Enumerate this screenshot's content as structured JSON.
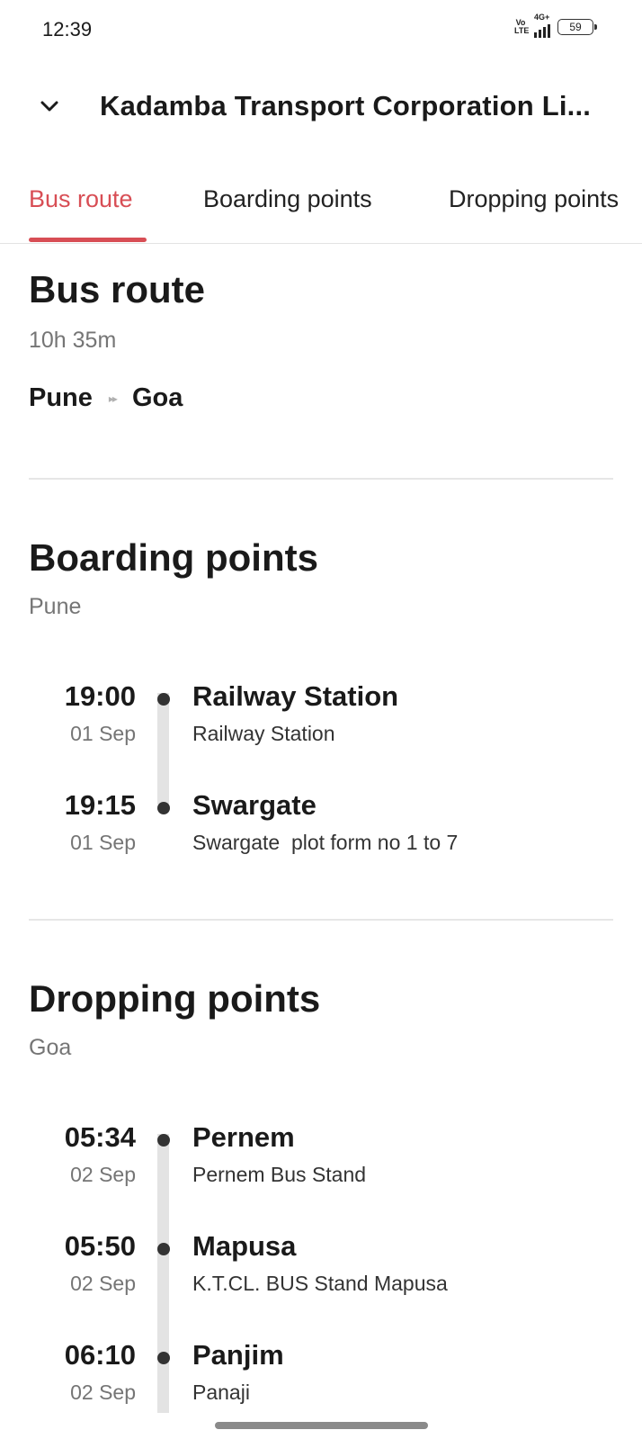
{
  "status_bar": {
    "time": "12:39",
    "volte": "Vo LTE",
    "network": "4G+",
    "battery": "59"
  },
  "header": {
    "title": "Kadamba Transport Corporation Li..."
  },
  "tabs": [
    {
      "label": "Bus route",
      "active": true
    },
    {
      "label": "Boarding points",
      "active": false
    },
    {
      "label": "Dropping points",
      "active": false
    }
  ],
  "bus_route": {
    "title": "Bus route",
    "duration": "10h 35m",
    "from": "Pune",
    "to": "Goa"
  },
  "boarding": {
    "title": "Boarding points",
    "city": "Pune",
    "stops": [
      {
        "time": "19:00",
        "date": "01 Sep",
        "name": "Railway Station",
        "address": "Railway Station"
      },
      {
        "time": "19:15",
        "date": "01 Sep",
        "name": "Swargate",
        "address": "Swargate  plot form no 1 to 7"
      }
    ]
  },
  "dropping": {
    "title": "Dropping points",
    "city": "Goa",
    "stops": [
      {
        "time": "05:34",
        "date": "02 Sep",
        "name": "Pernem",
        "address": "Pernem Bus Stand"
      },
      {
        "time": "05:50",
        "date": "02 Sep",
        "name": "Mapusa",
        "address": "K.T.CL. BUS Stand Mapusa"
      },
      {
        "time": "06:10",
        "date": "02 Sep",
        "name": "Panjim",
        "address": "Panaji"
      }
    ]
  },
  "colors": {
    "accent": "#d84e55",
    "muted": "#757575",
    "timeline": "#e3e3e3"
  }
}
